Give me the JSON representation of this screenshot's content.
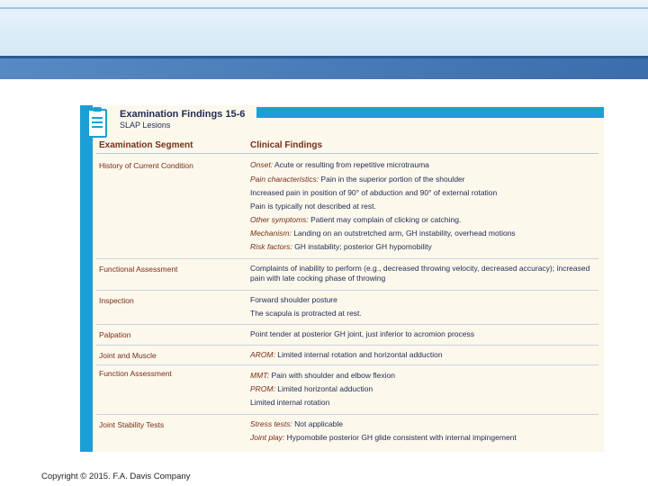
{
  "table": {
    "title": "Examination Findings 15-6",
    "subtitle": "SLAP Lesions",
    "col_segment": "Examination Segment",
    "col_findings": "Clinical Findings",
    "rows": [
      {
        "segment": "History of Current Condition",
        "findings": [
          {
            "label": "Onset:",
            "text": " Acute or resulting from repetitive microtrauma"
          },
          {
            "label": "Pain characteristics:",
            "text": " Pain in the superior portion of the shoulder"
          },
          {
            "label": "",
            "text": "Increased pain in position of 90° of abduction and 90° of external rotation"
          },
          {
            "label": "",
            "text": "Pain is typically not described at rest."
          },
          {
            "label": "Other symptoms:",
            "text": " Patient may complain of clicking or catching."
          },
          {
            "label": "Mechanism:",
            "text": " Landing on an outstretched arm, GH instability, overhead motions"
          },
          {
            "label": "Risk factors:",
            "text": " GH instability; posterior GH hypomobility"
          }
        ]
      },
      {
        "segment": "Functional Assessment",
        "findings": [
          {
            "label": "",
            "text": "Complaints of inability to perform (e.g., decreased throwing velocity, decreased accuracy); increased pain with late cocking phase of throwing"
          }
        ]
      },
      {
        "segment": "Inspection",
        "findings": [
          {
            "label": "",
            "text": "Forward shoulder posture"
          },
          {
            "label": "",
            "text": "The scapula is protracted at rest."
          }
        ]
      },
      {
        "segment": "Palpation",
        "findings": [
          {
            "label": "",
            "text": "Point tender at posterior GH joint, just inferior to acromion process"
          }
        ]
      },
      {
        "segment": "Joint and Muscle",
        "findings": [
          {
            "label": "AROM:",
            "text": " Limited internal rotation and horizontal adduction"
          }
        ]
      },
      {
        "segment": "Function Assessment",
        "findings": [
          {
            "label": "MMT:",
            "text": " Pain with shoulder and elbow flexion"
          },
          {
            "label": "PROM:",
            "text": " Limited horizontal adduction"
          },
          {
            "label": "",
            "text": "Limited internal rotation"
          }
        ]
      },
      {
        "segment": "Joint Stability Tests",
        "findings": [
          {
            "label": "Stress tests:",
            "text": " Not applicable"
          },
          {
            "label": "Joint play:",
            "text": " Hypomobile posterior GH glide consistent with internal impingement"
          }
        ]
      }
    ]
  },
  "footer": {
    "copyright": "Copyright © 2015. F.A. Davis Company"
  },
  "colors": {
    "accent": "#1c9fd4",
    "segment_text": "#7a2d17",
    "body_text": "#1f2a55"
  },
  "icons": {
    "table_icon": "clipboard-icon"
  }
}
